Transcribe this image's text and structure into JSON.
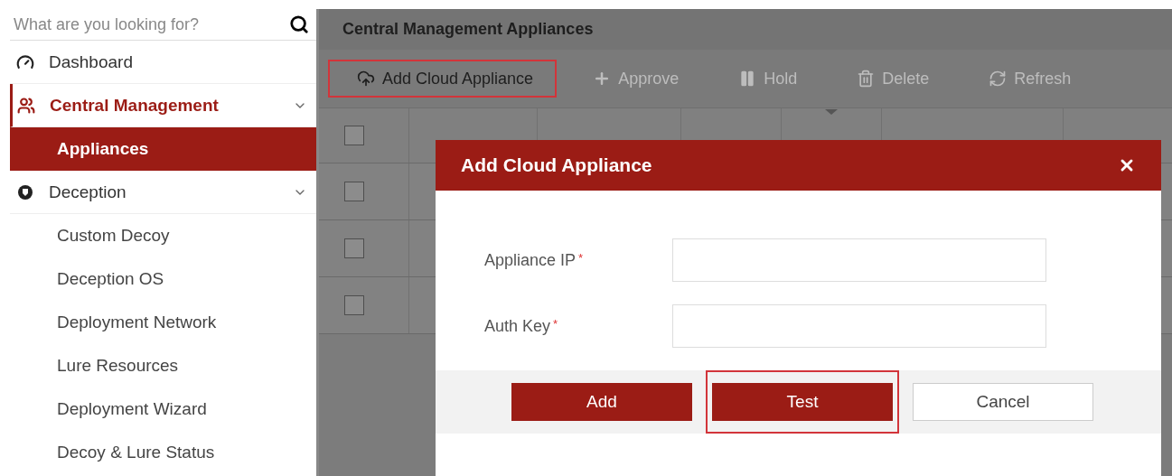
{
  "sidebar": {
    "search": {
      "placeholder": "What are you looking for?"
    },
    "items": [
      {
        "label": "Dashboard",
        "selected": false
      },
      {
        "label": "Central Management",
        "expanded": true,
        "selected": true,
        "children": [
          {
            "label": "Appliances",
            "selected": true
          }
        ]
      },
      {
        "label": "Deception",
        "expanded": true,
        "selected": false,
        "children": [
          {
            "label": "Custom Decoy",
            "selected": false
          },
          {
            "label": "Deception OS",
            "selected": false
          },
          {
            "label": "Deployment Network",
            "selected": false
          },
          {
            "label": "Lure Resources",
            "selected": false
          },
          {
            "label": "Deployment Wizard",
            "selected": false
          },
          {
            "label": "Decoy & Lure Status",
            "selected": false
          }
        ]
      }
    ]
  },
  "main": {
    "title": "Central Management Appliances",
    "toolbar": [
      {
        "label": "Add Cloud Appliance",
        "disabled": false,
        "highlighted": true
      },
      {
        "label": "Approve",
        "disabled": true,
        "highlighted": false
      },
      {
        "label": "Hold",
        "disabled": true,
        "highlighted": false
      },
      {
        "label": "Delete",
        "disabled": true,
        "highlighted": false
      },
      {
        "label": "Refresh",
        "disabled": true,
        "highlighted": false
      }
    ],
    "table": {
      "header_checked": false,
      "rows": [
        {
          "checked": false
        },
        {
          "checked": false
        },
        {
          "checked": false
        }
      ]
    }
  },
  "modal": {
    "title": "Add Cloud Appliance",
    "fields": [
      {
        "label": "Appliance IP",
        "required_mark": "*"
      },
      {
        "label": "Auth Key",
        "required_mark": "*"
      }
    ],
    "buttons": [
      {
        "label": "Add",
        "kind": "primary",
        "highlighted": false
      },
      {
        "label": "Test",
        "kind": "primary",
        "highlighted": true
      },
      {
        "label": "Cancel",
        "kind": "secondary",
        "highlighted": false
      }
    ]
  }
}
